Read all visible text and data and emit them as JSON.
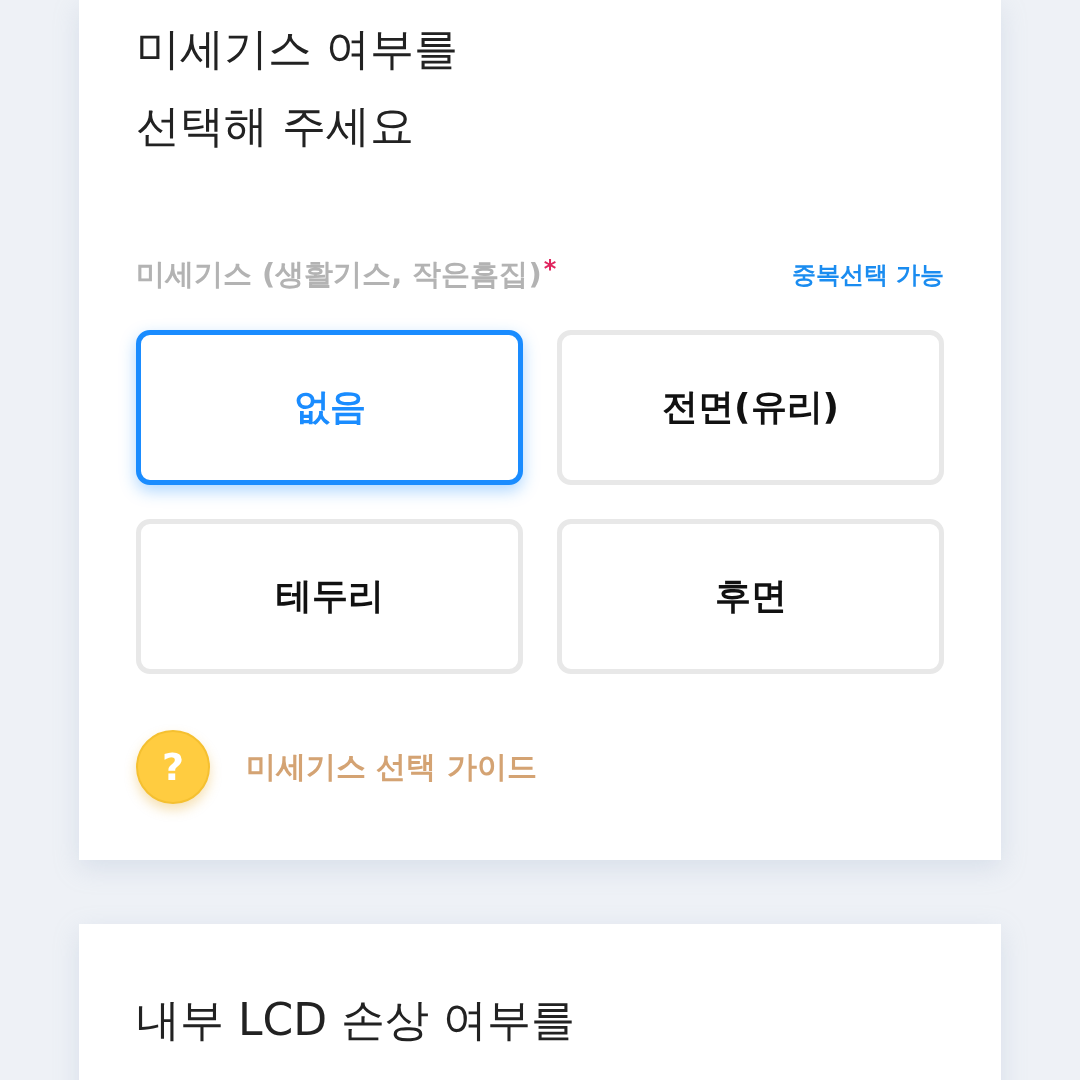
{
  "cards": [
    {
      "title_lines": [
        "미세기스 여부를",
        "선택해 주세요"
      ],
      "field": {
        "label": "미세기스 (생활기스, 작은흠집)",
        "required_mark": "*",
        "hint": "중복선택 가능"
      },
      "options": [
        {
          "label": "없음",
          "selected": true
        },
        {
          "label": "전면(유리)",
          "selected": false
        },
        {
          "label": "테두리",
          "selected": false
        },
        {
          "label": "후면",
          "selected": false
        }
      ],
      "guide": {
        "icon": "?",
        "label": "미세기스 선택 가이드"
      }
    },
    {
      "title_lines": [
        "내부 LCD 손상 여부를"
      ]
    }
  ]
}
